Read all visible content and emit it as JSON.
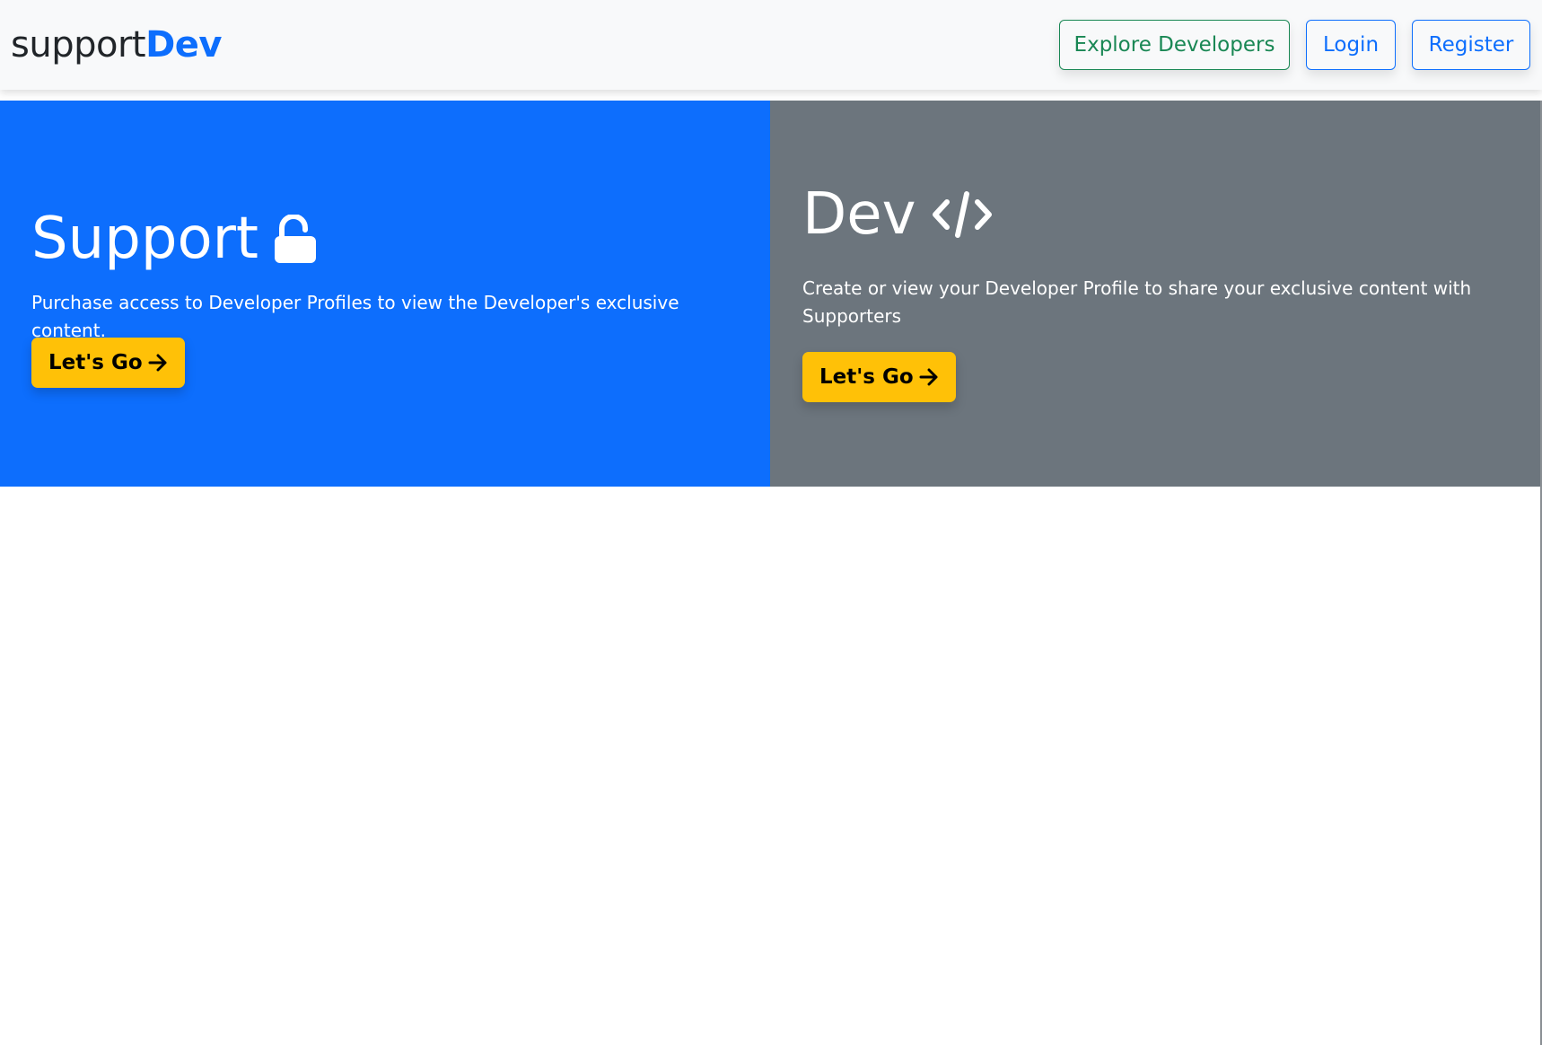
{
  "navbar": {
    "brand_prefix": "support",
    "brand_accent": "Dev",
    "explore_label": "Explore Developers",
    "login_label": "Login",
    "register_label": "Register"
  },
  "support_panel": {
    "title": "Support",
    "icon": "unlock-icon",
    "description": "Purchase access to Developer Profiles to view the Developer's exclusive content.",
    "button_label": "Let's Go",
    "button_icon": "arrow-right-icon"
  },
  "dev_panel": {
    "title": "Dev",
    "icon": "code-icon",
    "description": "Create or view your Developer Profile to share your exclusive content with Supporters",
    "button_label": "Let's Go",
    "button_icon": "arrow-right-icon"
  },
  "colors": {
    "primary": "#0d6efd",
    "secondary": "#6c757d",
    "success": "#198754",
    "warning": "#ffc107",
    "navbar_bg": "#f8f9fa"
  }
}
